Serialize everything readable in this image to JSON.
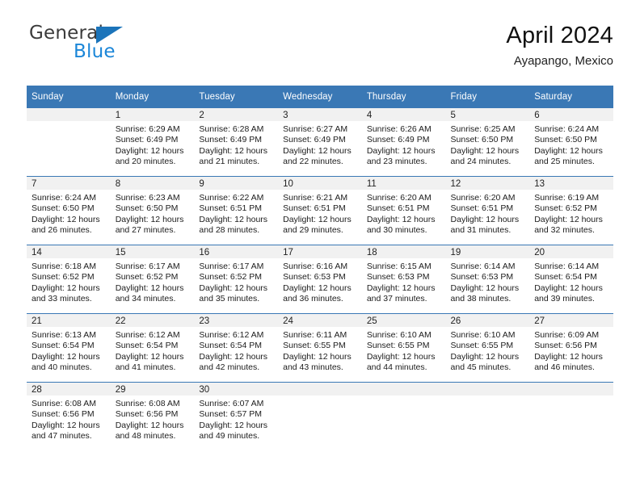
{
  "branding": {
    "logo_general": "General",
    "logo_blue": "Blue",
    "accent_color": "#1b74ba",
    "header_color": "#3a78b5"
  },
  "header": {
    "title": "April 2024",
    "location": "Ayapango, Mexico"
  },
  "weekdays": [
    "Sunday",
    "Monday",
    "Tuesday",
    "Wednesday",
    "Thursday",
    "Friday",
    "Saturday"
  ],
  "weeks": [
    [
      {
        "day": "",
        "sunrise": "",
        "sunset": "",
        "daylight1": "",
        "daylight2": ""
      },
      {
        "day": "1",
        "sunrise": "Sunrise: 6:29 AM",
        "sunset": "Sunset: 6:49 PM",
        "daylight1": "Daylight: 12 hours",
        "daylight2": "and 20 minutes."
      },
      {
        "day": "2",
        "sunrise": "Sunrise: 6:28 AM",
        "sunset": "Sunset: 6:49 PM",
        "daylight1": "Daylight: 12 hours",
        "daylight2": "and 21 minutes."
      },
      {
        "day": "3",
        "sunrise": "Sunrise: 6:27 AM",
        "sunset": "Sunset: 6:49 PM",
        "daylight1": "Daylight: 12 hours",
        "daylight2": "and 22 minutes."
      },
      {
        "day": "4",
        "sunrise": "Sunrise: 6:26 AM",
        "sunset": "Sunset: 6:49 PM",
        "daylight1": "Daylight: 12 hours",
        "daylight2": "and 23 minutes."
      },
      {
        "day": "5",
        "sunrise": "Sunrise: 6:25 AM",
        "sunset": "Sunset: 6:50 PM",
        "daylight1": "Daylight: 12 hours",
        "daylight2": "and 24 minutes."
      },
      {
        "day": "6",
        "sunrise": "Sunrise: 6:24 AM",
        "sunset": "Sunset: 6:50 PM",
        "daylight1": "Daylight: 12 hours",
        "daylight2": "and 25 minutes."
      }
    ],
    [
      {
        "day": "7",
        "sunrise": "Sunrise: 6:24 AM",
        "sunset": "Sunset: 6:50 PM",
        "daylight1": "Daylight: 12 hours",
        "daylight2": "and 26 minutes."
      },
      {
        "day": "8",
        "sunrise": "Sunrise: 6:23 AM",
        "sunset": "Sunset: 6:50 PM",
        "daylight1": "Daylight: 12 hours",
        "daylight2": "and 27 minutes."
      },
      {
        "day": "9",
        "sunrise": "Sunrise: 6:22 AM",
        "sunset": "Sunset: 6:51 PM",
        "daylight1": "Daylight: 12 hours",
        "daylight2": "and 28 minutes."
      },
      {
        "day": "10",
        "sunrise": "Sunrise: 6:21 AM",
        "sunset": "Sunset: 6:51 PM",
        "daylight1": "Daylight: 12 hours",
        "daylight2": "and 29 minutes."
      },
      {
        "day": "11",
        "sunrise": "Sunrise: 6:20 AM",
        "sunset": "Sunset: 6:51 PM",
        "daylight1": "Daylight: 12 hours",
        "daylight2": "and 30 minutes."
      },
      {
        "day": "12",
        "sunrise": "Sunrise: 6:20 AM",
        "sunset": "Sunset: 6:51 PM",
        "daylight1": "Daylight: 12 hours",
        "daylight2": "and 31 minutes."
      },
      {
        "day": "13",
        "sunrise": "Sunrise: 6:19 AM",
        "sunset": "Sunset: 6:52 PM",
        "daylight1": "Daylight: 12 hours",
        "daylight2": "and 32 minutes."
      }
    ],
    [
      {
        "day": "14",
        "sunrise": "Sunrise: 6:18 AM",
        "sunset": "Sunset: 6:52 PM",
        "daylight1": "Daylight: 12 hours",
        "daylight2": "and 33 minutes."
      },
      {
        "day": "15",
        "sunrise": "Sunrise: 6:17 AM",
        "sunset": "Sunset: 6:52 PM",
        "daylight1": "Daylight: 12 hours",
        "daylight2": "and 34 minutes."
      },
      {
        "day": "16",
        "sunrise": "Sunrise: 6:17 AM",
        "sunset": "Sunset: 6:52 PM",
        "daylight1": "Daylight: 12 hours",
        "daylight2": "and 35 minutes."
      },
      {
        "day": "17",
        "sunrise": "Sunrise: 6:16 AM",
        "sunset": "Sunset: 6:53 PM",
        "daylight1": "Daylight: 12 hours",
        "daylight2": "and 36 minutes."
      },
      {
        "day": "18",
        "sunrise": "Sunrise: 6:15 AM",
        "sunset": "Sunset: 6:53 PM",
        "daylight1": "Daylight: 12 hours",
        "daylight2": "and 37 minutes."
      },
      {
        "day": "19",
        "sunrise": "Sunrise: 6:14 AM",
        "sunset": "Sunset: 6:53 PM",
        "daylight1": "Daylight: 12 hours",
        "daylight2": "and 38 minutes."
      },
      {
        "day": "20",
        "sunrise": "Sunrise: 6:14 AM",
        "sunset": "Sunset: 6:54 PM",
        "daylight1": "Daylight: 12 hours",
        "daylight2": "and 39 minutes."
      }
    ],
    [
      {
        "day": "21",
        "sunrise": "Sunrise: 6:13 AM",
        "sunset": "Sunset: 6:54 PM",
        "daylight1": "Daylight: 12 hours",
        "daylight2": "and 40 minutes."
      },
      {
        "day": "22",
        "sunrise": "Sunrise: 6:12 AM",
        "sunset": "Sunset: 6:54 PM",
        "daylight1": "Daylight: 12 hours",
        "daylight2": "and 41 minutes."
      },
      {
        "day": "23",
        "sunrise": "Sunrise: 6:12 AM",
        "sunset": "Sunset: 6:54 PM",
        "daylight1": "Daylight: 12 hours",
        "daylight2": "and 42 minutes."
      },
      {
        "day": "24",
        "sunrise": "Sunrise: 6:11 AM",
        "sunset": "Sunset: 6:55 PM",
        "daylight1": "Daylight: 12 hours",
        "daylight2": "and 43 minutes."
      },
      {
        "day": "25",
        "sunrise": "Sunrise: 6:10 AM",
        "sunset": "Sunset: 6:55 PM",
        "daylight1": "Daylight: 12 hours",
        "daylight2": "and 44 minutes."
      },
      {
        "day": "26",
        "sunrise": "Sunrise: 6:10 AM",
        "sunset": "Sunset: 6:55 PM",
        "daylight1": "Daylight: 12 hours",
        "daylight2": "and 45 minutes."
      },
      {
        "day": "27",
        "sunrise": "Sunrise: 6:09 AM",
        "sunset": "Sunset: 6:56 PM",
        "daylight1": "Daylight: 12 hours",
        "daylight2": "and 46 minutes."
      }
    ],
    [
      {
        "day": "28",
        "sunrise": "Sunrise: 6:08 AM",
        "sunset": "Sunset: 6:56 PM",
        "daylight1": "Daylight: 12 hours",
        "daylight2": "and 47 minutes."
      },
      {
        "day": "29",
        "sunrise": "Sunrise: 6:08 AM",
        "sunset": "Sunset: 6:56 PM",
        "daylight1": "Daylight: 12 hours",
        "daylight2": "and 48 minutes."
      },
      {
        "day": "30",
        "sunrise": "Sunrise: 6:07 AM",
        "sunset": "Sunset: 6:57 PM",
        "daylight1": "Daylight: 12 hours",
        "daylight2": "and 49 minutes."
      },
      {
        "day": "",
        "sunrise": "",
        "sunset": "",
        "daylight1": "",
        "daylight2": ""
      },
      {
        "day": "",
        "sunrise": "",
        "sunset": "",
        "daylight1": "",
        "daylight2": ""
      },
      {
        "day": "",
        "sunrise": "",
        "sunset": "",
        "daylight1": "",
        "daylight2": ""
      },
      {
        "day": "",
        "sunrise": "",
        "sunset": "",
        "daylight1": "",
        "daylight2": ""
      }
    ]
  ]
}
